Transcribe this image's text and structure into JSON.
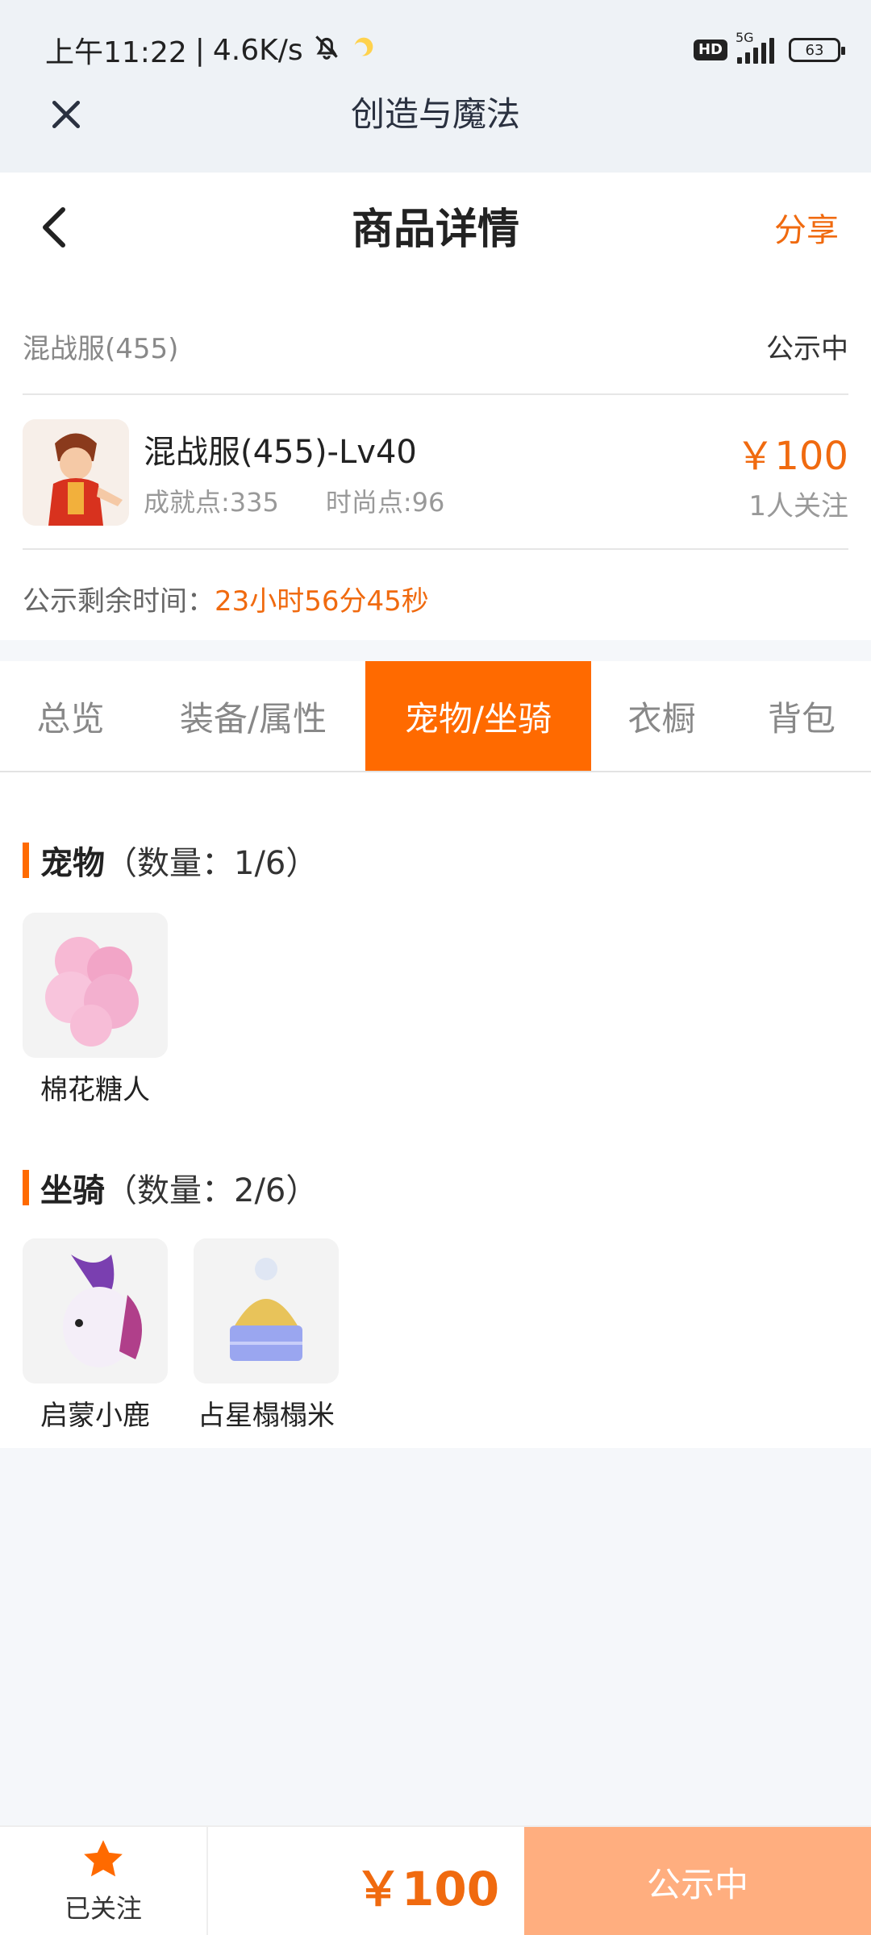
{
  "status_bar": {
    "time": "上午11:22",
    "separator": "|",
    "speed": "4.6K/s",
    "hd": "HD",
    "network": "5G",
    "battery": "63"
  },
  "mini_program": {
    "title": "创造与魔法"
  },
  "nav": {
    "title": "商品详情",
    "share": "分享"
  },
  "server": {
    "name": "混战服(455)",
    "status": "公示中"
  },
  "item": {
    "name": "混战服(455)-Lv40",
    "achievement": "成就点:335",
    "fashion": "时尚点:96",
    "price": "￥100",
    "watchers": "1人关注"
  },
  "countdown": {
    "label": "公示剩余时间：",
    "time": "23小时56分45秒"
  },
  "tabs": [
    {
      "label": "总览"
    },
    {
      "label": "装备/属性"
    },
    {
      "label": "宠物/坐骑",
      "active": true
    },
    {
      "label": "衣橱"
    },
    {
      "label": "背包"
    }
  ],
  "pets": {
    "title": "宠物",
    "count": "（数量：1/6）",
    "items": [
      {
        "name": "棉花糖人"
      }
    ]
  },
  "mounts": {
    "title": "坐骑",
    "count": "（数量：2/6）",
    "items": [
      {
        "name": "启蒙小鹿"
      },
      {
        "name": "占星榻榻米"
      }
    ]
  },
  "bottom": {
    "follow_label": "已关注",
    "price": "￥100",
    "status": "公示中"
  },
  "colors": {
    "accent": "#ff6a00",
    "price": "#f06a0f",
    "status_button": "#ffae7f"
  }
}
